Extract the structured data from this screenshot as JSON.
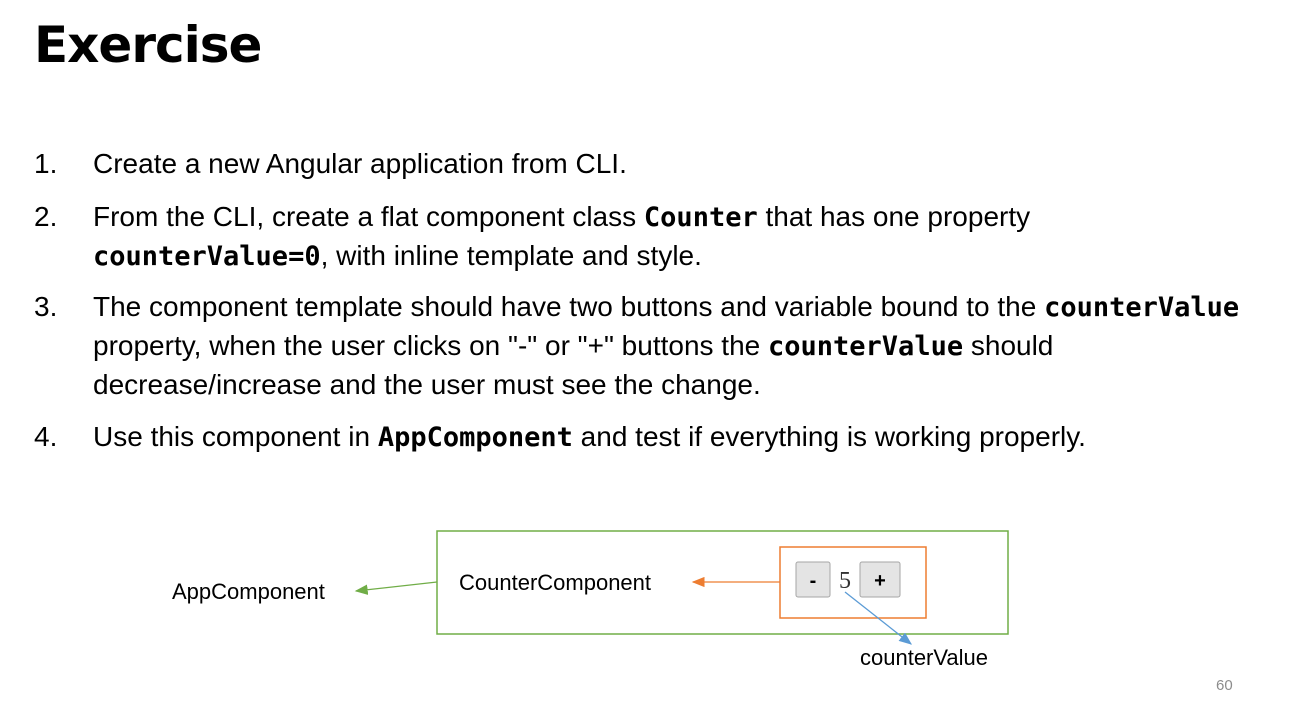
{
  "slide": {
    "title": "Exercise",
    "page_number": "60"
  },
  "list": [
    {
      "num": "1.",
      "parts": [
        {
          "text": "Create a new Angular application from CLI."
        }
      ]
    },
    {
      "num": "2.",
      "parts": [
        {
          "text": "From the CLI, create a flat component class "
        },
        {
          "code": "Counter"
        },
        {
          "text": " that has one property "
        },
        {
          "code": "counterValue=0"
        },
        {
          "text": ", with inline template and style."
        }
      ]
    },
    {
      "num": "3.",
      "parts": [
        {
          "text": "The component template should have two buttons and variable bound to the "
        },
        {
          "code": "counterValue"
        },
        {
          "text": " property, when the user clicks on \"-\" or \"+\" buttons the "
        },
        {
          "code": "counterValue"
        },
        {
          "text": " should decrease/increase and the user must see the change."
        }
      ]
    },
    {
      "num": "4.",
      "parts": [
        {
          "text": "Use this component in "
        },
        {
          "code": "AppComponent"
        },
        {
          "text": " and test if everything is working properly."
        }
      ]
    }
  ],
  "diagram": {
    "app_label": "AppComponent",
    "counter_label": "CounterComponent",
    "value_label": "counterValue",
    "minus_label": "-",
    "plus_label": "+",
    "display_value": "5",
    "colors": {
      "app_border": "#70ad47",
      "counter_border": "#ed7d31",
      "value_arrow": "#5b9bd5"
    }
  }
}
